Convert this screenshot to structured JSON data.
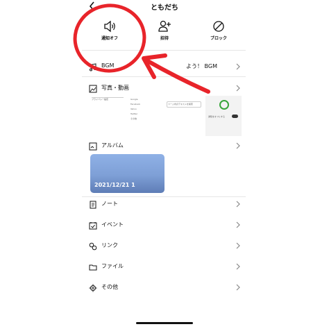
{
  "header": {
    "title": "ともだち",
    "back_icon": "chevron-left-icon"
  },
  "actions": [
    {
      "label": "通知オフ",
      "icon": "speaker-icon"
    },
    {
      "label": "招待",
      "icon": "add-user-icon"
    },
    {
      "label": "ブロック",
      "icon": "block-icon"
    }
  ],
  "bgm": {
    "label": "BGM",
    "hint": "よう！ BGM"
  },
  "photos": {
    "label": "写真・動画",
    "thumb1_text": "プライバシー設定",
    "thumb2_items": [
      "Google",
      "Facebook",
      "Yahoo",
      "Twitter",
      "その他"
    ],
    "thumb3_text": "ページ内のテキストを検索",
    "thumb4_text": "通知をオフにする"
  },
  "album": {
    "label": "アルバム",
    "card_date": "2021/12/21 1"
  },
  "menu": [
    {
      "label": "ノート",
      "icon": "note-icon"
    },
    {
      "label": "イベント",
      "icon": "calendar-check-icon"
    },
    {
      "label": "リンク",
      "icon": "link-icon"
    },
    {
      "label": "ファイル",
      "icon": "folder-icon"
    },
    {
      "label": "その他",
      "icon": "gear-icon"
    }
  ],
  "colors": {
    "annotation": "#e8242a",
    "album_card": "#8fb1e6"
  }
}
